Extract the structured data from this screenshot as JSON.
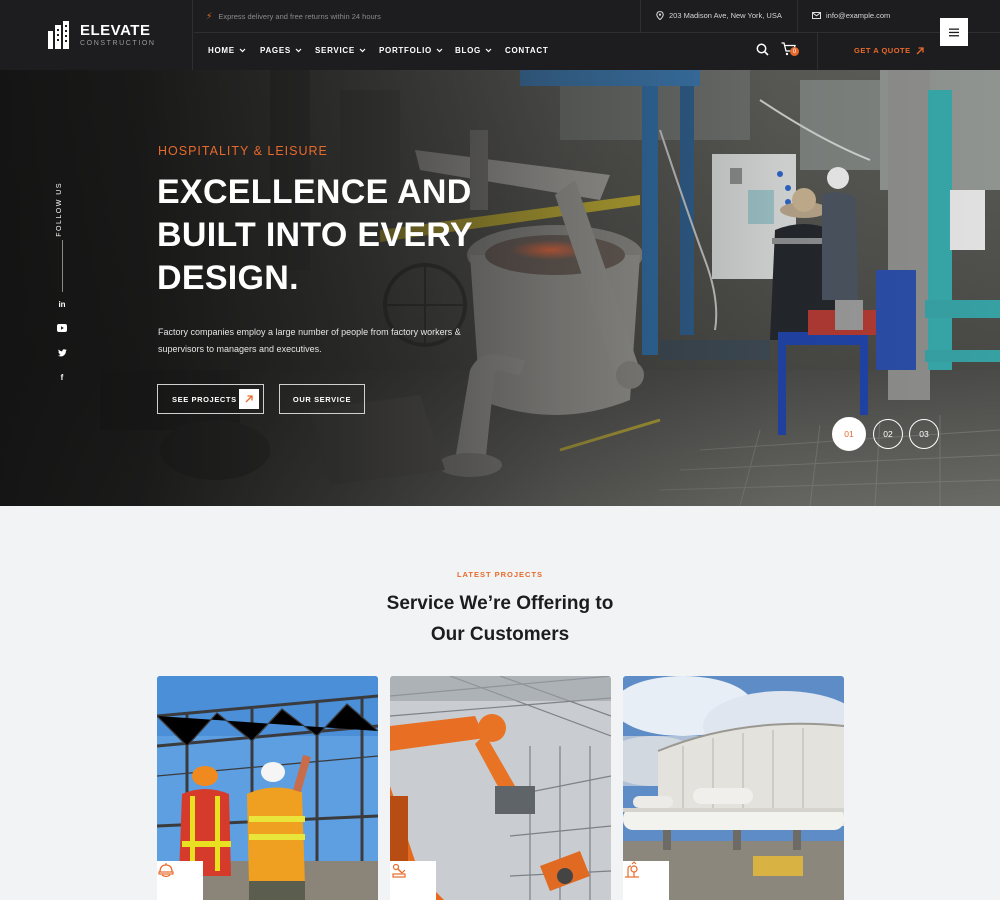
{
  "brand": {
    "name": "ELEVATE",
    "tagline": "CONSTRUCTION"
  },
  "topbar": {
    "notice": "Express delivery and free returns within 24 hours",
    "address": "203 Madison Ave, New York, USA",
    "email": "info@example.com"
  },
  "nav": {
    "items": [
      {
        "label": "HOME",
        "dropdown": true
      },
      {
        "label": "PAGES",
        "dropdown": true
      },
      {
        "label": "SERVICE",
        "dropdown": true
      },
      {
        "label": "PORTFOLIO",
        "dropdown": true
      },
      {
        "label": "BLOG",
        "dropdown": true
      },
      {
        "label": "CONTACT",
        "dropdown": false
      }
    ],
    "cart_count": "0",
    "quote_label": "GET A QUOTE"
  },
  "hero": {
    "follow_label": "FOLLOW US",
    "social_icons": [
      "linkedin-icon",
      "youtube-icon",
      "twitter-icon",
      "facebook-icon"
    ],
    "eyebrow": "HOSPITALITY & LEISURE",
    "title": "EXCELLENCE AND BUILT INTO EVERY DESIGN.",
    "text": "Factory companies employ a large number of people from factory workers & supervisors to managers and executives.",
    "primary_button": "SEE PROJECTS",
    "secondary_button": "OUR SERVICE",
    "slides": [
      "01",
      "02",
      "03"
    ],
    "active_slide": "01"
  },
  "services": {
    "eyebrow": "LATEST PROJECTS",
    "title_line1": "Service We’re Offering to",
    "title_line2": "Our Customers",
    "cards": [
      {
        "icon": "worker-helmet-icon"
      },
      {
        "icon": "robotic-arm-icon"
      },
      {
        "icon": "oil-refinery-icon"
      }
    ]
  },
  "colors": {
    "accent": "#e86a2b",
    "header_bg": "#1d1d1f",
    "section_bg": "#f2f3f5"
  }
}
